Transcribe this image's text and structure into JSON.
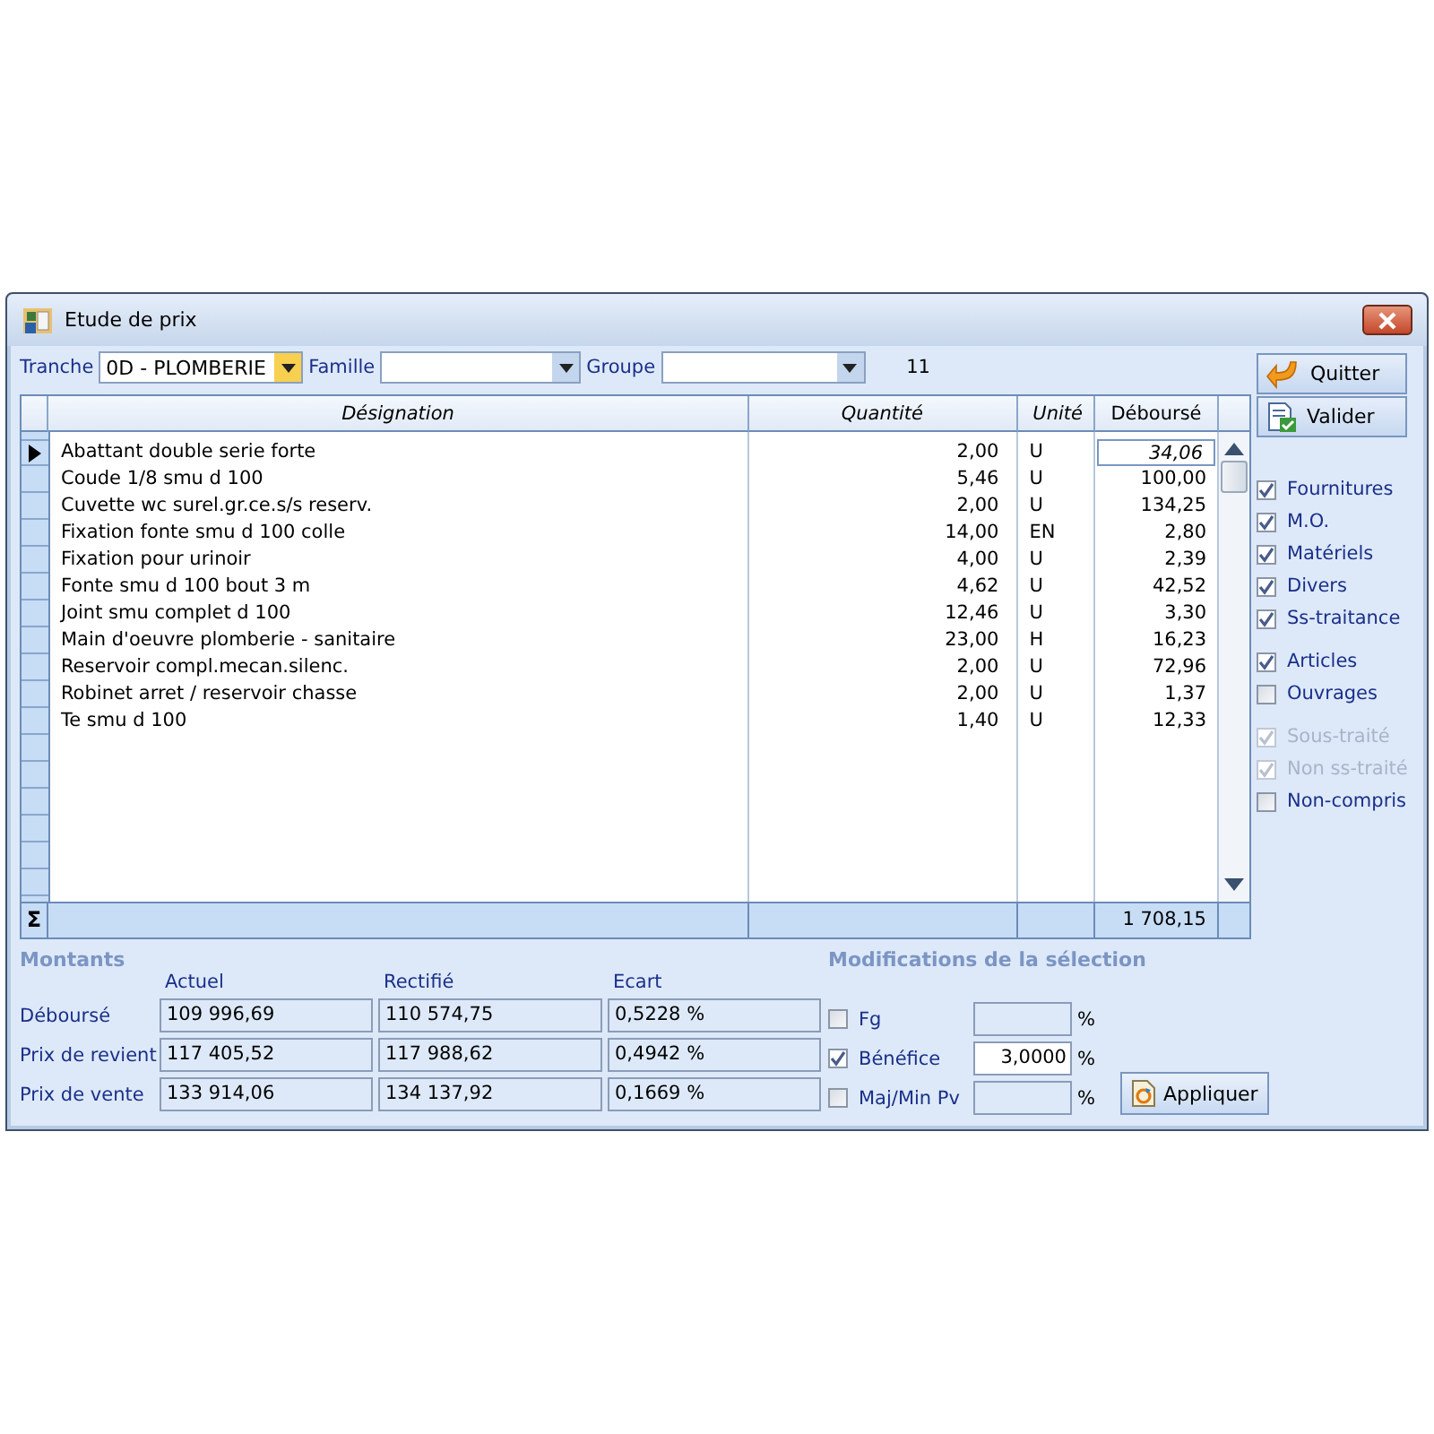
{
  "window": {
    "title": "Etude de prix"
  },
  "toolbar": {
    "combos": [
      {
        "label": "Tranche",
        "value": "0D - PLOMBERIE",
        "focused": true
      },
      {
        "label": "Famille",
        "focused": false
      },
      {
        "label": "Groupe",
        "focused": false
      }
    ],
    "count": "11"
  },
  "table": {
    "columns": [
      "Désignation",
      "Quantité",
      "Unité",
      "Déboursé"
    ],
    "rows": [
      {
        "designation": "Abattant double serie forte",
        "quantite": "2,00",
        "unite": "U",
        "debourse": "34,06",
        "selected": true
      },
      {
        "designation": "Coude 1/8 smu d 100",
        "quantite": "5,46",
        "unite": "U",
        "debourse": "100,00",
        "selected": false
      },
      {
        "designation": "Cuvette wc surel.gr.ce.s/s reserv.",
        "quantite": "2,00",
        "unite": "U",
        "debourse": "134,25",
        "selected": false
      },
      {
        "designation": "Fixation fonte smu d 100 colle",
        "quantite": "14,00",
        "unite": "EN",
        "debourse": "2,80",
        "selected": false
      },
      {
        "designation": "Fixation pour urinoir",
        "quantite": "4,00",
        "unite": "U",
        "debourse": "2,39",
        "selected": false
      },
      {
        "designation": "Fonte smu d 100 bout 3 m",
        "quantite": "4,62",
        "unite": "U",
        "debourse": "42,52",
        "selected": false
      },
      {
        "designation": "Joint smu complet d 100",
        "quantite": "12,46",
        "unite": "U",
        "debourse": "3,30",
        "selected": false
      },
      {
        "designation": "Main d'oeuvre plomberie - sanitaire",
        "quantite": "23,00",
        "unite": "H",
        "debourse": "16,23",
        "selected": false
      },
      {
        "designation": "Reservoir compl.mecan.silenc.",
        "quantite": "2,00",
        "unite": "U",
        "debourse": "72,96",
        "selected": false
      },
      {
        "designation": "Robinet arret / reservoir chasse",
        "quantite": "2,00",
        "unite": "U",
        "debourse": "1,37",
        "selected": false
      },
      {
        "designation": "Te smu d 100",
        "quantite": "1,40",
        "unite": "U",
        "debourse": "12,33",
        "selected": false
      }
    ],
    "total_symbol": "Σ",
    "total": "1 708,15"
  },
  "actions": [
    {
      "label": "Quitter",
      "kind": "quit"
    },
    {
      "label": "Valider",
      "kind": "validate"
    }
  ],
  "filters": [
    [
      {
        "label": "Fournitures",
        "checked": true,
        "disabled": false
      },
      {
        "label": "M.O.",
        "checked": true,
        "disabled": false
      },
      {
        "label": "Matériels",
        "checked": true,
        "disabled": false
      },
      {
        "label": "Divers",
        "checked": true,
        "disabled": false
      },
      {
        "label": "Ss-traitance",
        "checked": true,
        "disabled": false
      }
    ],
    [
      {
        "label": "Articles",
        "checked": true,
        "disabled": false
      },
      {
        "label": "Ouvrages",
        "checked": false,
        "disabled": false
      }
    ],
    [
      {
        "label": "Sous-traité",
        "checked": true,
        "disabled": true
      },
      {
        "label": "Non ss-traité",
        "checked": true,
        "disabled": true
      },
      {
        "label": "Non-compris",
        "checked": false,
        "disabled": false
      }
    ]
  ],
  "montants": {
    "title": "Montants",
    "columns": [
      "Actuel",
      "Rectifié",
      "Ecart"
    ],
    "rows": [
      {
        "label": "Déboursé",
        "values": [
          "109 996,69",
          "110 574,75",
          "0,5228 %"
        ]
      },
      {
        "label": "Prix de revient",
        "values": [
          "117 405,52",
          "117 988,62",
          "0,4942 %"
        ]
      },
      {
        "label": "Prix de vente",
        "values": [
          "133 914,06",
          "134 137,92",
          "0,1669 %"
        ]
      }
    ]
  },
  "modifications": {
    "title": "Modifications de la sélection",
    "rows": [
      {
        "label": "Fg",
        "checked": false,
        "unit": "%"
      },
      {
        "label": "Bénéfice",
        "checked": true,
        "value": "3,0000",
        "unit": "%"
      },
      {
        "label": "Maj/Min Pv",
        "checked": false,
        "unit": "%"
      }
    ],
    "apply": "Appliquer"
  }
}
